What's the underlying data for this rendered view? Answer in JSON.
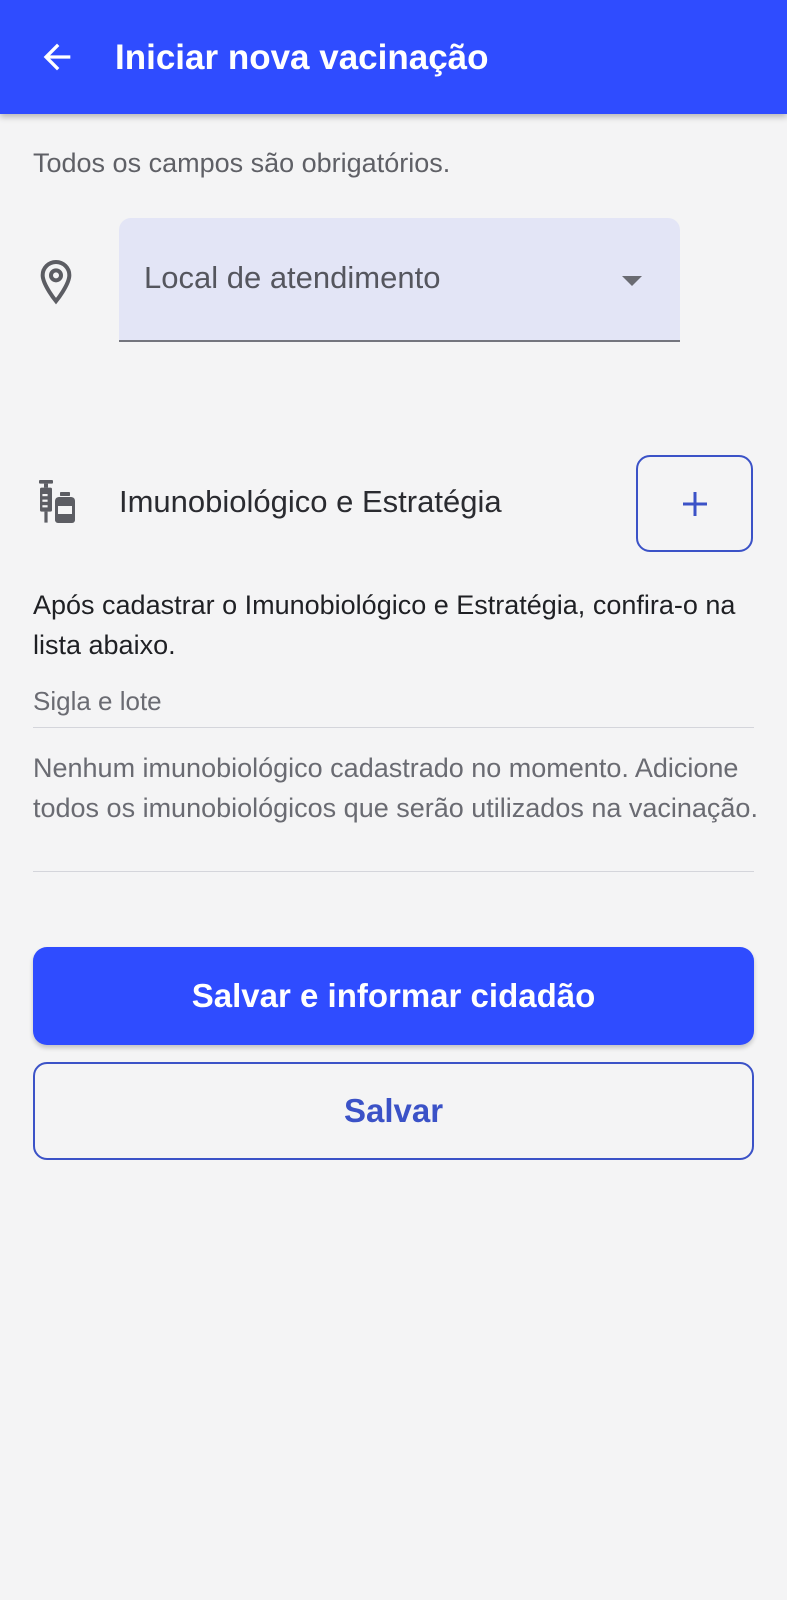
{
  "appbar": {
    "title": "Iniciar nova vacinação",
    "back_icon": "arrow-left-icon",
    "background": "#2f4cff"
  },
  "form": {
    "required_note": "Todos os campos são obrigatórios.",
    "location_icon": "map-pin-icon",
    "location_select": {
      "label": "Local de atendimento",
      "selected": ""
    }
  },
  "immuno_section": {
    "icon": "vaccine-icon",
    "title": "Imunobiológico e Estratégia",
    "add_icon": "plus-icon",
    "info": "Após cadastrar o Imunobiológico e Estratégia, confira-o na lista abaixo.",
    "list_header": "Sigla e lote",
    "empty_message": "Nenhum imunobiológico cadastrado no momento. Adicione todos os imunobiológicos que serão utilizados na vacinação."
  },
  "actions": {
    "primary_label": "Salvar e informar cidadão",
    "secondary_label": "Salvar",
    "accent": "#2f4cff"
  }
}
